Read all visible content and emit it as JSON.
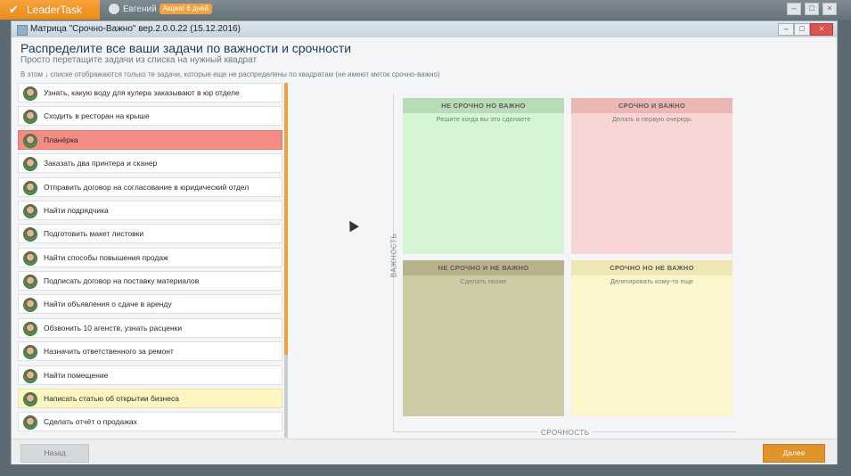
{
  "app": {
    "name": "LeaderTask",
    "user_name": "Евгений",
    "badge": "Акция! 6 дней"
  },
  "dialog": {
    "title": "Матрица \"Срочно-Важно\" вер.2.0.0.22 (15.12.2016)",
    "heading": "Распределите все ваши задачи по важности и срочности",
    "subheading": "Просто перетащите задачи из списка на нужный квадрат",
    "hint": "В этом ↓ списке отображаются только те задачи, которые еще не распределены по квадратам (не имеют меток срочно-важно)"
  },
  "tasks": [
    {
      "label": "Узнать, какую воду для кулера заказывают в юр отделе",
      "state": "normal"
    },
    {
      "label": "Сходить в ресторан на крыше",
      "state": "normal"
    },
    {
      "label": "Планёрка",
      "state": "highlight-red"
    },
    {
      "label": "Заказать два принтера и сканер",
      "state": "normal"
    },
    {
      "label": "Отправить договор на согласование в юридический отдел",
      "state": "normal"
    },
    {
      "label": "Найти подрядчика",
      "state": "normal"
    },
    {
      "label": "Подготовить макет листовки",
      "state": "normal"
    },
    {
      "label": "Найти способы повышения продаж",
      "state": "normal"
    },
    {
      "label": "Подписать договор на поставку материалов",
      "state": "normal"
    },
    {
      "label": "Найти объявления о сдаче в аренду",
      "state": "normal"
    },
    {
      "label": "Обзвонить 10 агенств, узнать расценки",
      "state": "normal"
    },
    {
      "label": "Назначить ответственного за ремонт",
      "state": "normal"
    },
    {
      "label": "Найти помещение",
      "state": "normal"
    },
    {
      "label": "Написать статью об открытии бизнеса",
      "state": "highlight-yellow"
    },
    {
      "label": "Сделать отчёт о продажах",
      "state": "normal"
    }
  ],
  "matrix": {
    "axis_y": "ВАЖНОСТЬ",
    "axis_x": "СРОЧНОСТЬ",
    "quadrants": {
      "top_left": {
        "title": "НЕ СРОЧНО НО ВАЖНО",
        "subtitle": "Решите когда вы это сделаете"
      },
      "top_right": {
        "title": "СРОЧНО И ВАЖНО",
        "subtitle": "Делать в первую очередь"
      },
      "bottom_left": {
        "title": "НЕ СРОЧНО И НЕ ВАЖНО",
        "subtitle": "Сделать позже"
      },
      "bottom_right": {
        "title": "СРОЧНО НО НЕ ВАЖНО",
        "subtitle": "Делегировать кому-то еще"
      }
    }
  },
  "buttons": {
    "back": "Назад",
    "done": "Далее"
  },
  "colors": {
    "accent": "#e98b1a",
    "highlight_red": "#f38c85",
    "highlight_yellow": "#fdf6c3",
    "quad_top_left": "#d5f5d4",
    "quad_top_right": "#f7d6d5",
    "quad_bottom_left": "#cdcca5",
    "quad_bottom_right": "#fbf6cc"
  }
}
